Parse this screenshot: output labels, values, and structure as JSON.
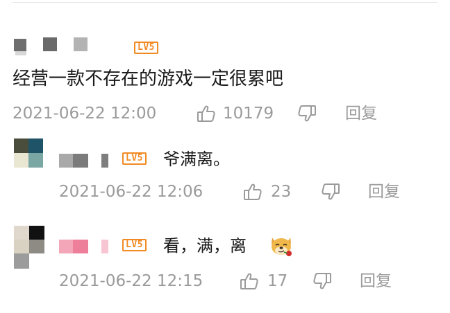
{
  "comment": {
    "text": "经营一款不存在的游戏一定很累吧",
    "level_badge": "LV5",
    "timestamp": "2021-06-22 12:00",
    "like_count": "10179",
    "reply_label": "回复"
  },
  "replies": [
    {
      "level_badge": "LV5",
      "text": "爷满离。",
      "timestamp": "2021-06-22 12:06",
      "like_count": "23",
      "reply_label": "回复"
    },
    {
      "level_badge": "LV5",
      "text": "看，满，离",
      "emoji": "doge-rose-emoji",
      "timestamp": "2021-06-22 12:15",
      "like_count": "17",
      "reply_label": "回复"
    }
  ],
  "colors": {
    "meta": "#9a9a9a",
    "badge": "#f28a24",
    "text": "#1a1a1a"
  },
  "icons": [
    "thumbs-up-icon",
    "thumbs-down-icon"
  ]
}
